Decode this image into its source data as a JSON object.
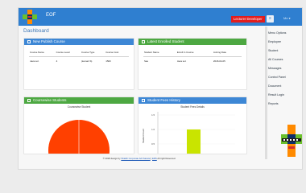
{
  "header": {
    "title": "EOF",
    "role_badge": "Lecturer Developer",
    "user_label": "Me ▾",
    "menu_button": "≡"
  },
  "page": {
    "title": "Dashboard"
  },
  "new_courses": {
    "title": "New Publish Course",
    "columns": [
      "Course Name",
      "Course Level",
      "Course Type",
      "Course Cost"
    ],
    "rows": [
      [
        "Java sol.",
        "4",
        "(kemari S)",
        "1500"
      ]
    ]
  },
  "enrolled": {
    "title": "Latest Enrolled Student",
    "columns": [
      "Student Name",
      "Enroll in Course",
      "Joining Date"
    ],
    "rows": [
      [
        "Sas",
        "Java sol.",
        "2018-04-05"
      ]
    ]
  },
  "coursewise": {
    "title": "Coursewise Students",
    "chart_title": "Coursewise Student"
  },
  "fees": {
    "title": "Student Fees History",
    "chart_title": "Student Fees Details",
    "yaxis_label": "Student Count",
    "ticks": [
      "1.5",
      "1.0",
      "0.5"
    ]
  },
  "sidebar": {
    "items": [
      "Menu Options",
      "Employee",
      "Student",
      "All Courses",
      "Messages",
      "Control Panel",
      "Document",
      "Result Login",
      "Reports"
    ]
  },
  "footer": {
    "prefix": "© 2018 design by",
    "link1": "Shaikh Corporate Arif-Sarwar",
    "mid": "|",
    "link2": "ERS",
    "suffix": "All right Reserved."
  },
  "chart_data": [
    {
      "type": "pie",
      "title": "Coursewise Student",
      "colors": [
        "#ff4000"
      ]
    },
    {
      "type": "bar",
      "title": "Student Fees Details",
      "ylabel": "Student Count",
      "ylim": [
        0,
        1.5
      ],
      "values": [
        1
      ],
      "colors": [
        "#c9e400"
      ]
    }
  ]
}
